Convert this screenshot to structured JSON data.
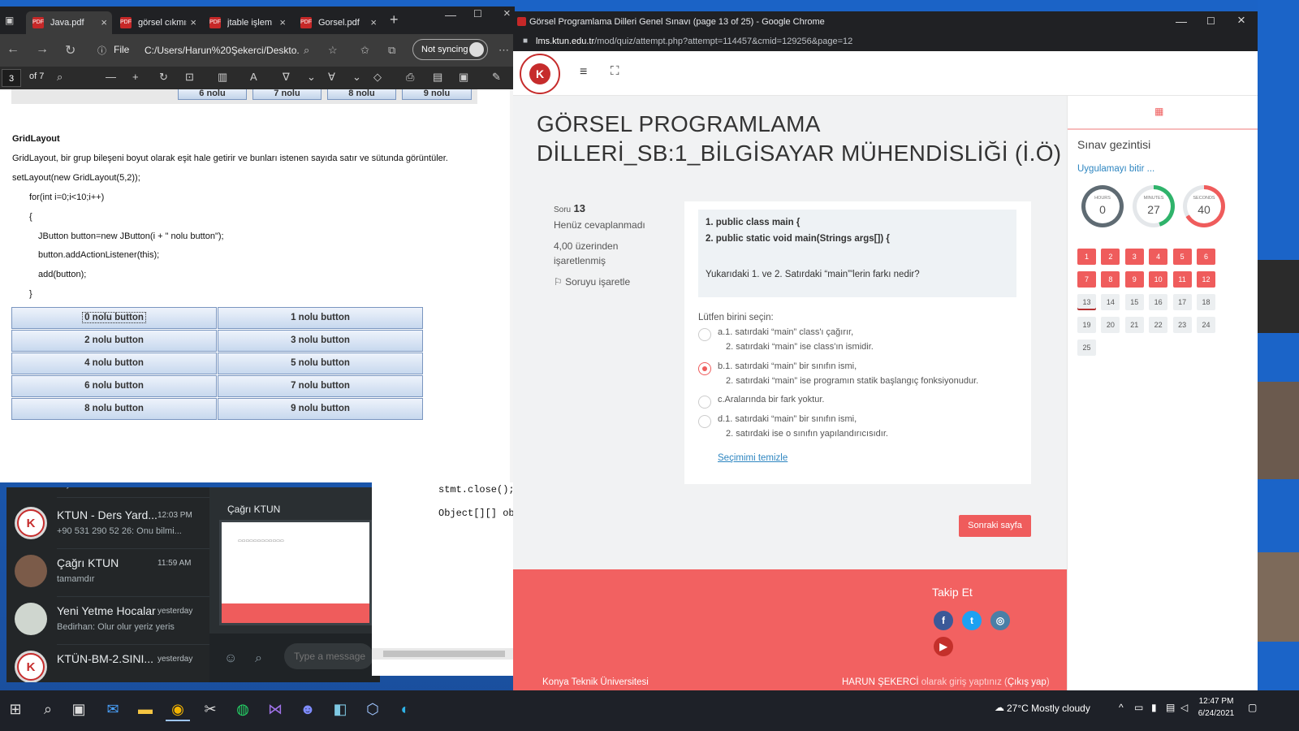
{
  "pdf_viewer": {
    "tabs": [
      {
        "title": "Java.pdf"
      },
      {
        "title": "görsel cıkmış"
      },
      {
        "title": "jtable işlem"
      },
      {
        "title": "Gorsel.pdf"
      }
    ],
    "address": {
      "scheme": "File",
      "url": "C:/Users/Harun%20Şekerci/Deskto..."
    },
    "sync_label": "Not syncing",
    "page_current": "3",
    "page_total": "of 7",
    "top_buttons": [
      "6 nolu",
      "7 nolu",
      "8 nolu",
      "9 nolu"
    ],
    "heading": "GridLayout",
    "paragraph": "GridLayout, bir grup bileşeni boyut olarak eşit hale getirir ve bunları istenen sayıda satır ve sütunda görüntüler.",
    "code": [
      "setLayout(new GridLayout(5,2));",
      "for(int i=0;i<10;i++)",
      "{",
      "JButton button=new JButton(i + \" nolu button\");",
      "button.addActionListener(this);",
      "add(button);",
      "}"
    ],
    "grid_buttons": [
      "0 nolu button",
      "1 nolu button",
      "2 nolu button",
      "3 nolu button",
      "4 nolu button",
      "5 nolu button",
      "6 nolu button",
      "7 nolu button",
      "8 nolu button",
      "9 nolu button"
    ]
  },
  "chat_app": {
    "top_fragment": "oky",
    "chats": [
      {
        "name": "KTUN - Ders Yard...",
        "time": "12:03 PM",
        "message": "+90 531 290 52 26: Onu bilmi..."
      },
      {
        "name": "Çağrı KTUN",
        "time": "11:59 AM",
        "message": "tamamdır"
      },
      {
        "name": "Yeni Yetme Hocalar",
        "time": "yesterday",
        "message": "Bedirhan: Olur olur yeriz yeris"
      },
      {
        "name": "KTÜN-BM-2.SINI...",
        "time": "yesterday",
        "message": ""
      }
    ],
    "open_chat_title": "Çağrı KTUN",
    "input_placeholder": "Type a message"
  },
  "code_editor": {
    "lines": [
      "stmt.close();",
      "Object[][] obj"
    ]
  },
  "chrome": {
    "window_title": "Görsel Programlama Dilleri Genel Sınavı (page 13 of 25) - Google Chrome",
    "url_host": "lms.ktun.edu.tr",
    "url_path": "/mod/quiz/attempt.php?attempt=114457&cmid=129256&page=12"
  },
  "quiz": {
    "course_title": "GÖRSEL PROGRAMLAMA DİLLERİ_SB:1_BİLGİSAYAR MÜHENDİSLİĞİ (İ.Ö)",
    "question": {
      "label": "Soru",
      "number": "13",
      "status": "Henüz cevaplanmadı",
      "points": "4,00 üzerinden işaretlenmiş",
      "flag_label": "Soruyu işaretle",
      "code_line1": "1. public class main {",
      "code_line2": "2. public static void main(Strings args[]) {",
      "prompt": "Yukarıdaki 1. ve 2. Satırdaki “main”'lerin farkı nedir?",
      "choose_label": "Lütfen birini seçin:",
      "answers": [
        {
          "line1": "a.1. satırdaki “main” class'ı çağırır,",
          "line2": "2. satırdaki “main” ise class'ın ismidir.",
          "checked": false
        },
        {
          "line1": "b.1. satırdaki “main” bir sınıfın ismi,",
          "line2": "2. satırdaki “main” ise programın statik başlangıç fonksiyonudur.",
          "checked": true
        },
        {
          "line1": "c.Aralarında bir fark yoktur.",
          "line2": "",
          "checked": false
        },
        {
          "line1": "d.1. satırdaki “main” bir sınıfın ismi,",
          "line2": "2. satırdaki ise o sınıfın yapılandırıcısıdır.",
          "checked": false
        }
      ],
      "clear_label": "Seçimimi temizle"
    },
    "next_button": "Sonraki sayfa",
    "footer": {
      "follow_title": "Takip Et",
      "university": "Konya Teknik Üniversitesi",
      "user": "HARUN ŞEKERCİ",
      "login_text": " olarak giriş yaptınız (",
      "logout": "Çıkış yap",
      "close_paren": ")"
    },
    "sidebar": {
      "title": "Sınav gezintisi",
      "finish_link": "Uygulamayı bitir ...",
      "timer": {
        "hours_label": "HOURS",
        "hours": "0",
        "minutes_label": "MINUTES",
        "minutes": "27",
        "seconds_label": "SECONDS",
        "seconds": "40"
      },
      "questions": [
        "1",
        "2",
        "3",
        "4",
        "5",
        "6",
        "7",
        "8",
        "9",
        "10",
        "11",
        "12",
        "13",
        "14",
        "15",
        "16",
        "17",
        "18",
        "19",
        "20",
        "21",
        "22",
        "23",
        "24",
        "25"
      ],
      "answered_count": 12
    },
    "colors": {
      "accent": "#ef5c5c",
      "link": "#2e86c1",
      "timer_hours": "#5f6b73",
      "timer_minutes": "#2fb36b",
      "timer_seconds": "#ef5c5c"
    }
  },
  "taskbar": {
    "weather": "27°C  Mostly cloudy",
    "time": "12:47 PM",
    "date": "6/24/2021"
  }
}
